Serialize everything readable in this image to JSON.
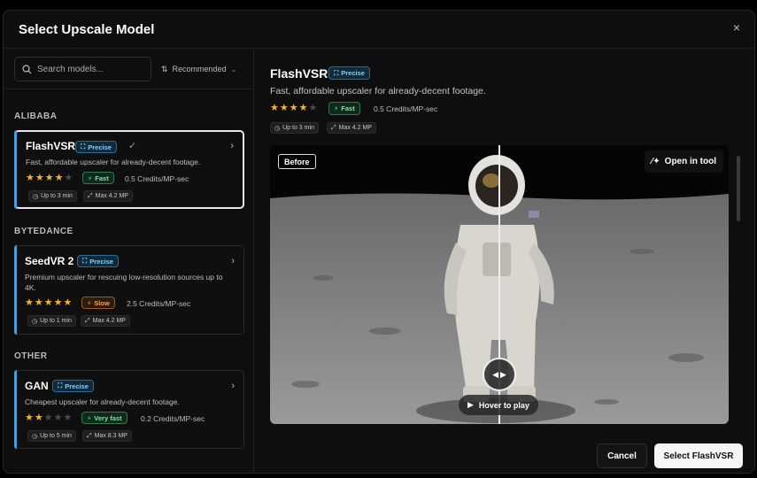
{
  "modal": {
    "title": "Select Upscale Model",
    "close": "×"
  },
  "search": {
    "placeholder": "Search models..."
  },
  "sort": {
    "label": "Recommended"
  },
  "groups": [
    "ALIBABA",
    "BYTEDANCE",
    "OTHER"
  ],
  "models": [
    {
      "name": "FlashVSR",
      "badge": "Precise",
      "desc": "Fast, affordable upscaler for already-decent footage.",
      "rating": 4,
      "speed": "Fast",
      "credits": "0.5 Credits/MP-sec",
      "time": "Up to 3 min",
      "max": "Max 4.2 MP",
      "selected": true
    },
    {
      "name": "SeedVR 2",
      "badge": "Precise",
      "desc": "Premium upscaler for rescuing low-resolution sources up to 4K.",
      "rating": 5,
      "speed": "Slow",
      "credits": "2.5 Credits/MP-sec",
      "time": "Up to 1 min",
      "max": "Max 4.2 MP",
      "selected": false
    },
    {
      "name": "GAN",
      "badge": "Precise",
      "desc": "Cheapest upscaler for already-decent footage.",
      "rating": 2,
      "speed": "Very fast",
      "credits": "0.2 Credits/MP-sec",
      "time": "Up to 5 min",
      "max": "Max 8.3 MP",
      "selected": false
    }
  ],
  "detail": {
    "name": "FlashVSR",
    "badge": "Precise",
    "desc": "Fast, affordable upscaler for already-decent footage.",
    "rating": 4,
    "speed": "Fast",
    "credits": "0.5 Credits/MP-sec",
    "time": "Up to 3 min",
    "max": "Max 4.2 MP"
  },
  "preview": {
    "before_label": "Before",
    "open_tool": "Open in tool",
    "hover_play": "Hover to play",
    "split_position": 0.5
  },
  "footer": {
    "cancel": "Cancel",
    "select": "Select FlashVSR"
  },
  "colors": {
    "accent_bar": "#4a9fd8",
    "star": "#f3b431",
    "precise": "#8cd0f5",
    "fast": "#7ee3a5",
    "slow": "#f2a55a"
  }
}
